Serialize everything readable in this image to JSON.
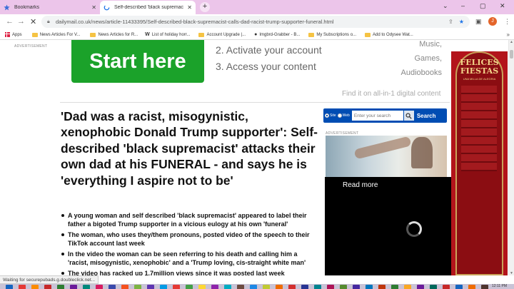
{
  "tabs": [
    {
      "label": "Bookmarks",
      "active": false
    },
    {
      "label": "Self-described 'black supremac",
      "active": true
    }
  ],
  "window_controls": [
    "–",
    "▢",
    "✕"
  ],
  "address_bar": {
    "url": "dailymail.co.uk/news/article-11433395/Self-described-black-supremacist-calls-dad-racist-trump-supporter-funeral.html"
  },
  "profile_initial": "J",
  "bookmarks": [
    {
      "label": "Apps",
      "icon": "apps-grid-icon"
    },
    {
      "label": "News Articles For V...",
      "icon": "folder-icon"
    },
    {
      "label": "News Articles for R...",
      "icon": "folder-icon"
    },
    {
      "label": "List of holiday horr...",
      "icon": "wikipedia-icon"
    },
    {
      "label": "Account Upgrade |...",
      "icon": "folder-icon"
    },
    {
      "label": "Imgbrd-Grabber - B...",
      "icon": "github-icon"
    },
    {
      "label": "My Subscriptions o...",
      "icon": "folder-icon"
    },
    {
      "label": "Add to Odysee Wat...",
      "icon": "folder-icon"
    }
  ],
  "ad_top": {
    "label": "ADVERTISEMENT",
    "button": "Start here",
    "steps": [
      "2. Activate your account",
      "3. Access your content"
    ],
    "categories": [
      "Music,",
      "Games,",
      "Audiobooks"
    ],
    "footer": "Find it on all-in-1 digital content"
  },
  "article": {
    "headline": "'Dad was a racist, misogynistic, xenophobic Donald Trump supporter': Self-described 'black supremacist' attacks their own dad at his FUNERAL - and says he is 'everything I aspire not to be'",
    "bullets": [
      "A young woman and self described 'black supremacist' appeared to label their father a bigoted Trump supporter in a vicious eulogy at his own 'funeral'",
      "The woman, who uses they/them pronouns, posted video of the speech to their TikTok account last week",
      "In the video the woman can be seen referring to his death and calling him a 'racist, misogynistic, xenophobic' and a 'Trump loving, cis-straight white man'",
      "The video has racked up 1.7million views since it was posted last week"
    ]
  },
  "site_search": {
    "options": [
      "Site",
      "Web"
    ],
    "placeholder": "Enter your search",
    "button": "Search"
  },
  "side_ad_label": "ADVERTISEMENT",
  "video_overlay": {
    "read_more": "Read more",
    "close": "✕"
  },
  "right_ad": {
    "title_line1": "FELICES",
    "title_line2": "FIESTAS",
    "subtitle": "UNA MILLA DE ALEGRIA"
  },
  "status_bar": "Waiting for securepubads.g.doubleclick.net...",
  "taskbar": {
    "clock": "12:11 PM",
    "icon_colors": [
      "#1565c0",
      "#e53935",
      "#fb8c00",
      "#c62828",
      "#2e7d32",
      "#6a1b9a",
      "#00897b",
      "#d81b60",
      "#3949ab",
      "#f4511e",
      "#7cb342",
      "#5e35b1",
      "#039be5",
      "#e53935",
      "#43a047",
      "#fdd835",
      "#8e24aa",
      "#00acc1",
      "#6d4c41",
      "#1e88e5",
      "#c0ca33",
      "#ef6c00",
      "#d32f2f",
      "#283593",
      "#00838f",
      "#ad1457",
      "#558b2f",
      "#4527a0",
      "#0277bd",
      "#bf360c",
      "#2e7d32",
      "#f9a825",
      "#6a1b9a",
      "#00695c",
      "#c62828",
      "#1565c0",
      "#ef6c00",
      "#4e342e",
      "#37474f",
      "#9e9d24"
    ]
  }
}
